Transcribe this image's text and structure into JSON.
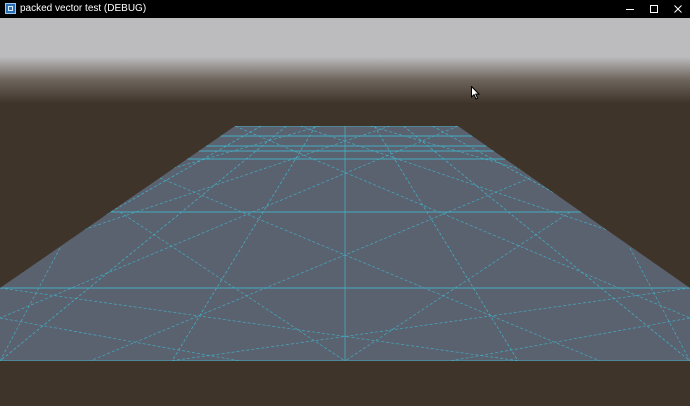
{
  "window": {
    "title": "packed vector test (DEBUG)",
    "icon": "app-icon",
    "controls": [
      "minimize-icon",
      "maximize-icon",
      "close-icon"
    ]
  },
  "scene": {
    "sky_top_color": "#bcbcbe",
    "horizon_color": "#6d645b",
    "ground_color": "#3e342a",
    "plane_color": "#5a6270",
    "grid_line_color": "#41b8cf",
    "cursor_icon": "mouse-pointer-icon"
  }
}
